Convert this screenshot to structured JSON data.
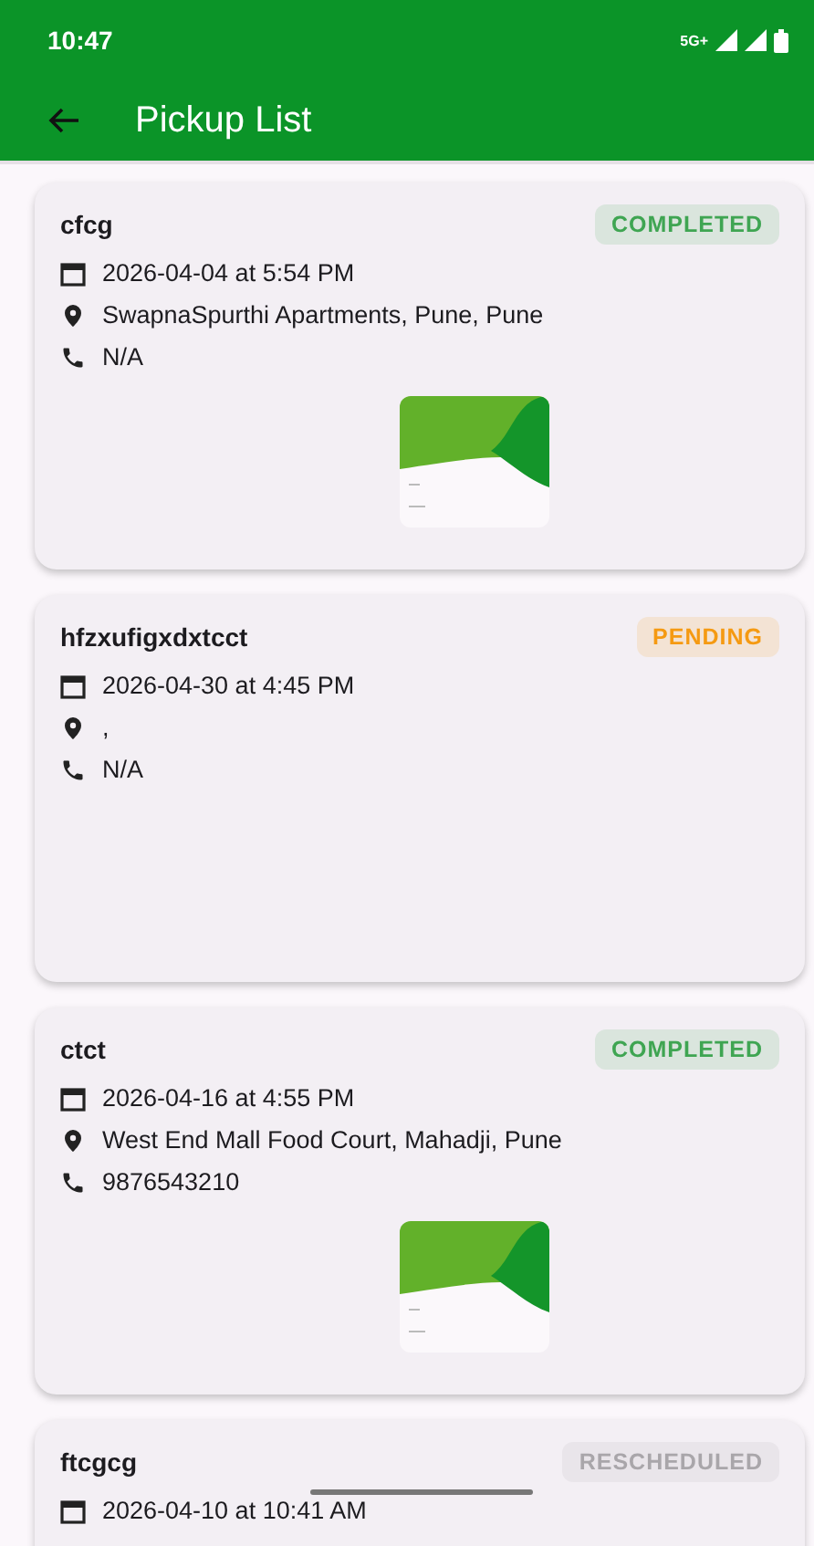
{
  "status_bar": {
    "time": "10:47",
    "network": "5G+"
  },
  "app_bar": {
    "title": "Pickup List"
  },
  "pickups": [
    {
      "name": "cfcg",
      "status": "COMPLETED",
      "color": "#3fa552",
      "date": "2026-04-04 at 5:54 PM",
      "address": "SwapnaSpurthi Apartments, Pune, Pune",
      "phone": "N/A"
    },
    {
      "name": "hfzxufigxdxtcct",
      "status": "PENDING",
      "color": "#f59a12",
      "date": "2026-04-30 at 4:45 PM",
      "address": ",",
      "phone": "N/A"
    },
    {
      "name": "ctct",
      "status": "COMPLETED",
      "color": "#3fa552",
      "date": "2026-04-16 at 4:55 PM",
      "address": "West End Mall Food Court, Mahadji, Pune",
      "phone": "9876543210"
    },
    {
      "name": "ftcgcg",
      "status": "RESCHEDULED",
      "color": "#a9a6aa",
      "date": "2026-04-10 at 10:41 AM"
    }
  ]
}
